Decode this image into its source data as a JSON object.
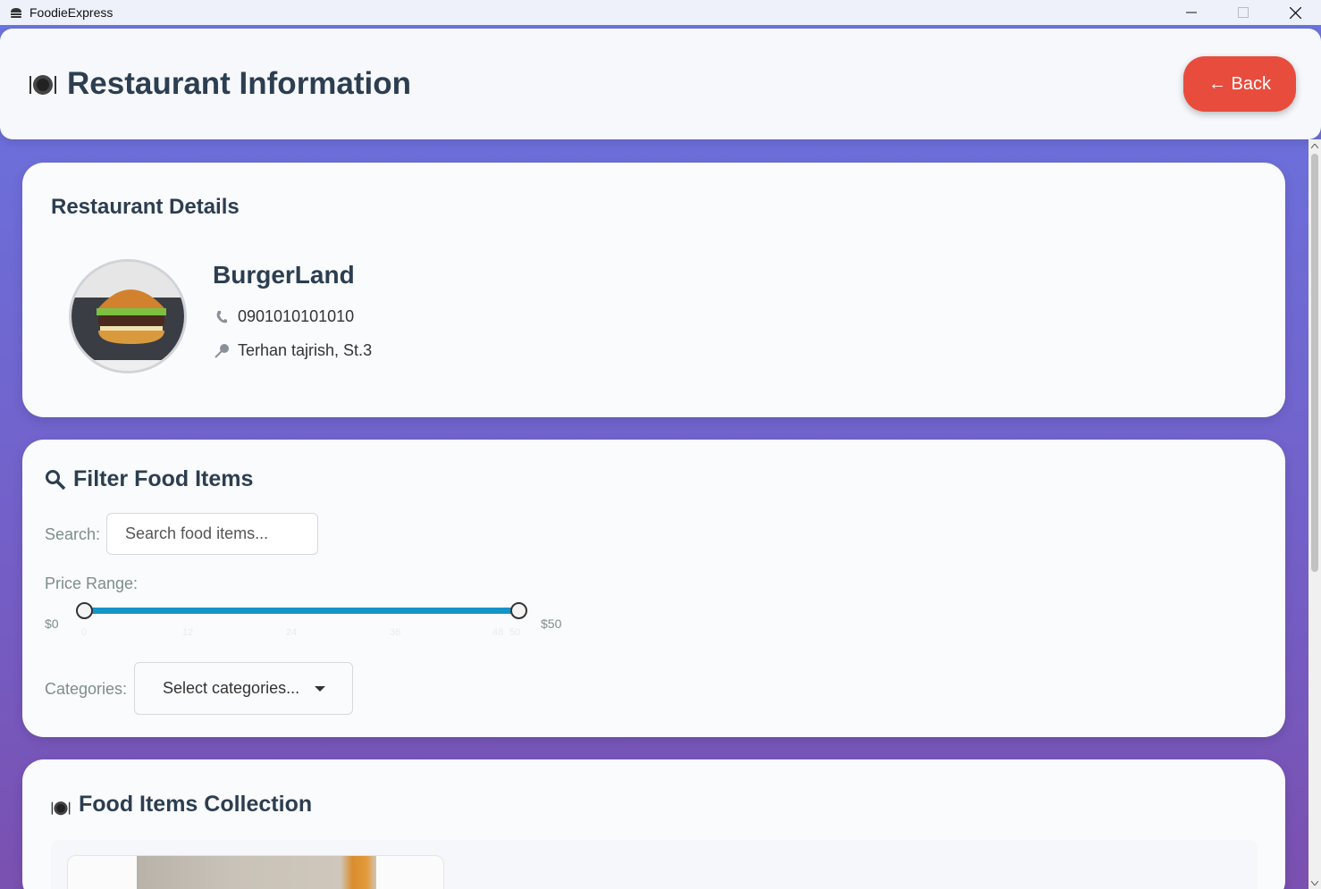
{
  "window": {
    "app_title": "FoodieExpress",
    "app_icon": "burger-icon"
  },
  "header": {
    "title": "Restaurant Information",
    "title_icon": "plate-icon",
    "back_label": "← Back"
  },
  "details": {
    "section_title": "Restaurant Details",
    "name": "BurgerLand",
    "phone": "0901010101010",
    "address": "Terhan tajrish, St.3"
  },
  "filter": {
    "section_title": "Filter Food Items",
    "search_label": "Search:",
    "search_placeholder": "Search food items...",
    "price_label": "Price Range:",
    "price_min_label": "$0",
    "price_max_label": "$50",
    "price_range": {
      "min": 0,
      "max": 50,
      "selected_min": 0,
      "selected_max": 50
    },
    "ticks": [
      "0",
      "12",
      "24",
      "36",
      "48",
      "50"
    ],
    "categories_label": "Categories:",
    "categories_placeholder": "Select categories..."
  },
  "items": {
    "section_title": "Food Items Collection"
  },
  "colors": {
    "back_button": "#e84c3d",
    "slider": "#1495c8",
    "background_top": "#6a74e0",
    "background_bottom": "#7a50b0"
  }
}
